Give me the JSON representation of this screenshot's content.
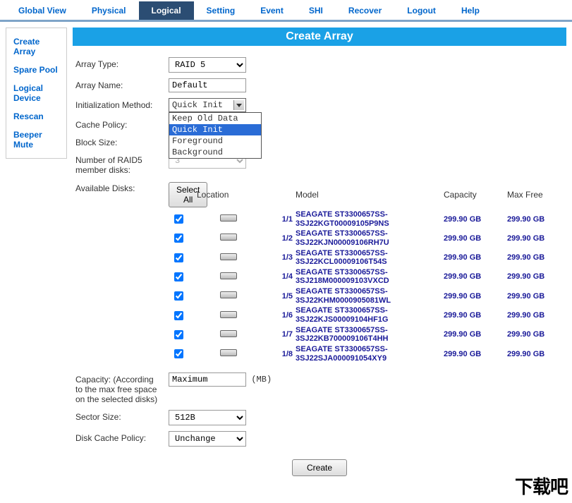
{
  "tabs": {
    "global_view": "Global View",
    "physical": "Physical",
    "logical": "Logical",
    "setting": "Setting",
    "event": "Event",
    "shi": "SHI",
    "recover": "Recover",
    "logout": "Logout",
    "help": "Help"
  },
  "sidebar": {
    "items": [
      {
        "label": "Create Array"
      },
      {
        "label": "Spare Pool"
      },
      {
        "label": "Logical Device"
      },
      {
        "label": "Rescan"
      },
      {
        "label": "Beeper Mute"
      }
    ]
  },
  "title": "Create Array",
  "form": {
    "array_type_label": "Array Type:",
    "array_type_value": "RAID 5",
    "array_name_label": "Array Name:",
    "array_name_value": "Default",
    "init_method_label": "Initialization Method:",
    "init_method_value": "Quick Init",
    "init_method_options": [
      "Keep Old Data",
      "Quick Init",
      "Foreground",
      "Background"
    ],
    "cache_policy_label": "Cache Policy:",
    "block_size_label": "Block Size:",
    "member_disks_label": "Number of RAID5 member disks:",
    "member_disks_value": "3",
    "select_all_label": "Select All",
    "headers": {
      "location": "Location",
      "model": "Model",
      "capacity": "Capacity",
      "max_free": "Max Free"
    },
    "available_disks_label": "Available Disks:",
    "disks": [
      {
        "checked": true,
        "location": "1/1",
        "model": "SEAGATE ST3300657SS-3SJ22KGT00009105P9NS",
        "capacity": "299.90 GB",
        "max_free": "299.90 GB"
      },
      {
        "checked": true,
        "location": "1/2",
        "model": "SEAGATE ST3300657SS-3SJ22KJN00009106RH7U",
        "capacity": "299.90 GB",
        "max_free": "299.90 GB"
      },
      {
        "checked": true,
        "location": "1/3",
        "model": "SEAGATE ST3300657SS-3SJ22KCL00009106T54S",
        "capacity": "299.90 GB",
        "max_free": "299.90 GB"
      },
      {
        "checked": true,
        "location": "1/4",
        "model": "SEAGATE ST3300657SS-3SJ218M000009103VXCD",
        "capacity": "299.90 GB",
        "max_free": "299.90 GB"
      },
      {
        "checked": true,
        "location": "1/5",
        "model": "SEAGATE ST3300657SS-3SJ22KHM0000905081WL",
        "capacity": "299.90 GB",
        "max_free": "299.90 GB"
      },
      {
        "checked": true,
        "location": "1/6",
        "model": "SEAGATE ST3300657SS-3SJ22KJS00009104HF1G",
        "capacity": "299.90 GB",
        "max_free": "299.90 GB"
      },
      {
        "checked": true,
        "location": "1/7",
        "model": "SEAGATE ST3300657SS-3SJ22KB700009106T4HH",
        "capacity": "299.90 GB",
        "max_free": "299.90 GB"
      },
      {
        "checked": true,
        "location": "1/8",
        "model": "SEAGATE ST3300657SS-3SJ22SJA000091054XY9",
        "capacity": "299.90 GB",
        "max_free": "299.90 GB"
      }
    ],
    "capacity_label": "Capacity: (According to the max free space on the selected disks)",
    "capacity_value": "Maximum",
    "capacity_unit": "(MB)",
    "sector_size_label": "Sector Size:",
    "sector_size_value": "512B",
    "disk_cache_policy_label": "Disk Cache Policy:",
    "disk_cache_policy_value": "Unchange",
    "create_label": "Create"
  },
  "watermark": "下载吧"
}
